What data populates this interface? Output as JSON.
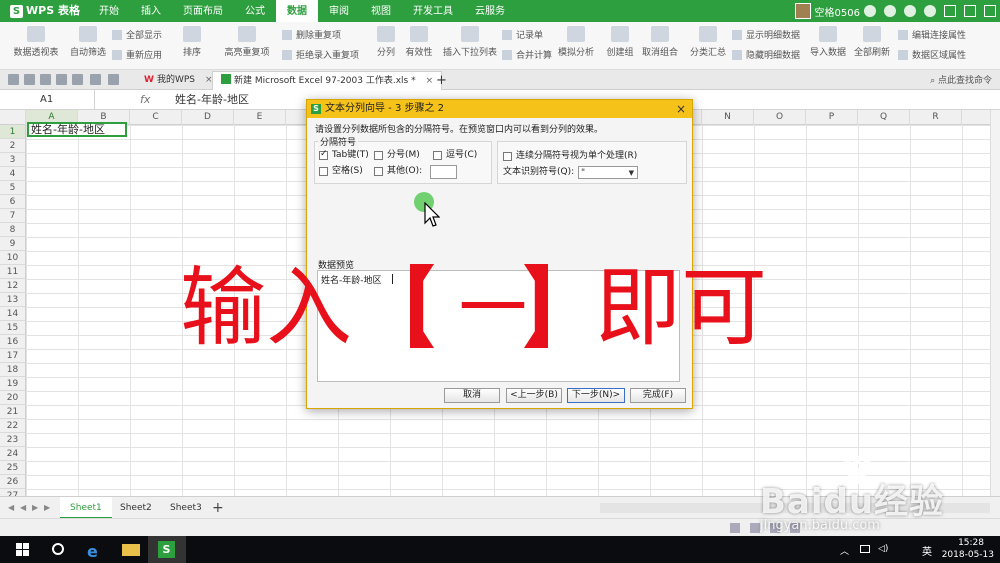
{
  "app": {
    "name": "WPS 表格",
    "logo_letter": "S"
  },
  "ribbon_tabs": [
    "开始",
    "插入",
    "页面布局",
    "公式",
    "数据",
    "审阅",
    "视图",
    "开发工具",
    "云服务"
  ],
  "active_tab_index": 4,
  "user": {
    "name": "空格0506"
  },
  "ribbon": {
    "pivot": "数据透视表",
    "auto_filter": "自动筛选",
    "show_all": "全部显示",
    "reapply": "重新应用",
    "sort": "排序",
    "highlight_dup": "高亮重复项",
    "remove_dup": "删除重复项",
    "reject_dup": "拒绝录入重复项",
    "split": "分列",
    "validity": "有效性",
    "insert_dropdown": "插入下拉列表",
    "record_form": "记录单",
    "merge_calc": "合并计算",
    "simulate": "模拟分析",
    "create_group": "创建组",
    "ungroup": "取消组合",
    "subtotal": "分类汇总",
    "show_detail": "显示明细数据",
    "hide_detail": "隐藏明细数据",
    "import": "导入数据",
    "refresh_all": "全部刷新",
    "edit_links": "编辑连接属性",
    "data_range": "数据区域属性"
  },
  "doc_tabs": [
    {
      "label": "我的WPS",
      "close": "×"
    },
    {
      "label": "新建 Microsoft Excel 97-2003 工作表.xls *",
      "close": "×"
    }
  ],
  "add_tab": "+",
  "search_placeholder": "点此查找命令",
  "formula": {
    "cell_ref": "A1",
    "fx": "fx",
    "content": "姓名-年龄-地区"
  },
  "columns": [
    "A",
    "B",
    "C",
    "D",
    "E",
    "F",
    "G",
    "H",
    "I",
    "J",
    "K",
    "L",
    "M",
    "N",
    "O",
    "P",
    "Q",
    "R"
  ],
  "rows": [
    "1",
    "2",
    "3",
    "4",
    "5",
    "6",
    "7",
    "8",
    "9",
    "10",
    "11",
    "12",
    "13",
    "14",
    "15",
    "16",
    "17",
    "18",
    "19",
    "20",
    "21",
    "22",
    "23",
    "24",
    "25",
    "26",
    "27"
  ],
  "cell_a1": "姓名-年龄-地区",
  "sheets": [
    "Sheet1",
    "Sheet2",
    "Sheet3"
  ],
  "active_sheet_index": 0,
  "add_sheet": "+",
  "dialog": {
    "title": "文本分列向导 - 3 步骤之 2",
    "close": "×",
    "instruction": "请设置分列数据所包含的分隔符号。在预览窗口内可以看到分列的效果。",
    "delimiter_legend": "分隔符号",
    "options": {
      "tab": "Tab键(T)",
      "semicolon": "分号(M)",
      "comma": "逗号(C)",
      "space": "空格(S)",
      "other": "其他(O):",
      "consecutive": "连续分隔符号视为单个处理(R)",
      "qualifier_label": "文本识别符号(Q):"
    },
    "checked": {
      "tab": true,
      "semicolon": false,
      "comma": false,
      "space": false,
      "other": false,
      "consecutive": false
    },
    "qualifier_value": "\"",
    "preview_legend": "数据预览",
    "preview_text": "姓名-年龄-地区",
    "buttons": {
      "cancel": "取消",
      "prev": "<上一步(B)",
      "next": "下一步(N)>",
      "finish": "完成(F)"
    }
  },
  "overlay": {
    "part1": "输入",
    "dash": "－",
    "part2": "即可",
    "color": "#e8101a"
  },
  "watermark": {
    "brand": "Baidu经验",
    "url": "jingyan.baidu.com"
  },
  "taskbar": {
    "ime": "英",
    "time": "15:28",
    "date": "2018-05-13"
  },
  "colors": {
    "wps_green": "#2e9f3f",
    "dialog_title": "#f5c21a"
  }
}
